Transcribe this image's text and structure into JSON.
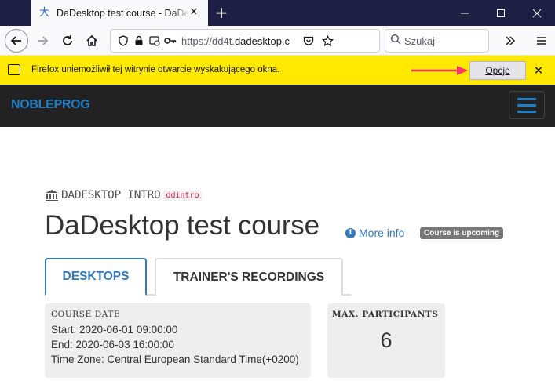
{
  "browser": {
    "tab_title": "DaDesktop test course - DaDesktop",
    "tab_favicon": "kanji-favicon-icon",
    "url_prefix": "https://dd4t.",
    "url_host": "dadesktop.c",
    "search_placeholder": "Szukaj",
    "toolbar_icons": [
      "back-icon",
      "forward-icon",
      "reload-icon",
      "home-icon",
      "overflow-icon",
      "menu-icon"
    ]
  },
  "notification": {
    "message": "Firefox uniemożliwił tej witrynie otwarcie wyskakującego okna.",
    "button_label": "Opcje",
    "background": "#ffe900",
    "arrow_color": "#ff3366"
  },
  "site": {
    "logo": "NOBLEPROG",
    "header_bg": "#222222",
    "accent": "#1f7fc6"
  },
  "course": {
    "category": "DADESKTOP INTRO",
    "code": "ddintro",
    "title": "DaDesktop test course",
    "more_info": "More info",
    "status_badge": "Course is upcoming"
  },
  "tabs": [
    {
      "label": "DESKTOPS",
      "active": true
    },
    {
      "label": "TRAINER'S RECORDINGS",
      "active": false
    }
  ],
  "course_date": {
    "label": "COURSE DATE",
    "start": "Start: 2020-06-01 09:00:00",
    "end": "End: 2020-06-03 16:00:00",
    "timezone": "Time Zone: Central European Standard Time(+0200)"
  },
  "participants": {
    "label": "MAX. PARTICIPANTS",
    "value": "6"
  }
}
